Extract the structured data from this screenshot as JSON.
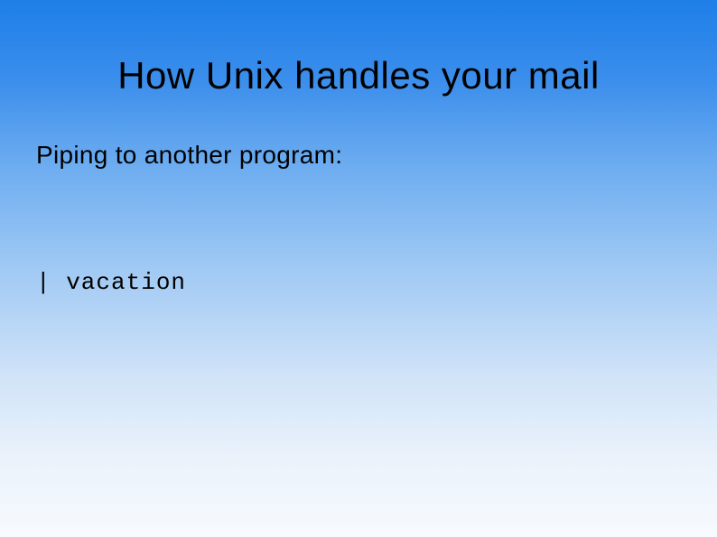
{
  "slide": {
    "title": "How Unix handles your mail",
    "subtitle": "Piping to another program:",
    "code": "| vacation"
  }
}
